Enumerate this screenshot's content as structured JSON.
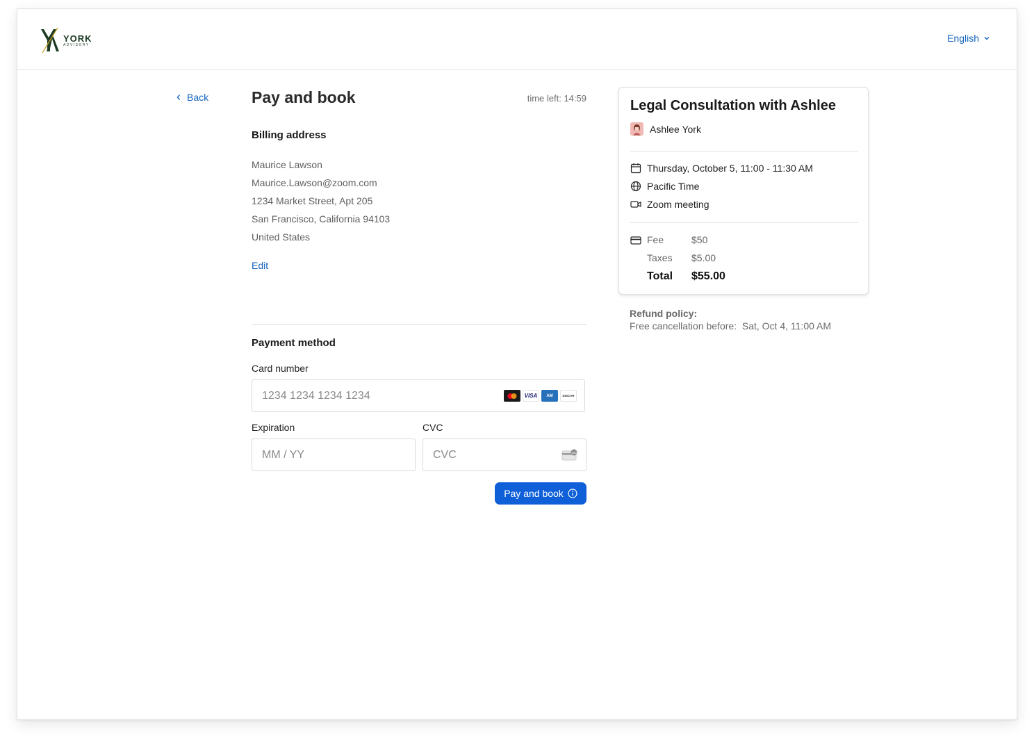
{
  "header": {
    "logo_mark": "YA",
    "logo_name": "YORK",
    "logo_sub": "ADVISORY",
    "language": "English"
  },
  "nav": {
    "back_label": "Back"
  },
  "checkout": {
    "title": "Pay and book",
    "timer": "time left: 14:59",
    "billing": {
      "title": "Billing address",
      "lines": [
        "Maurice Lawson",
        "Maurice.Lawson@zoom.com",
        "1234 Market Street, Apt 205",
        "San Francisco, California 94103",
        "United States"
      ],
      "edit_label": "Edit"
    },
    "payment": {
      "title": "Payment method",
      "card_label": "Card number",
      "card_placeholder": "1234 1234 1234 1234",
      "expiration_label": "Expiration",
      "expiration_placeholder": "MM / YY",
      "cvc_label": "CVC",
      "cvc_placeholder": "CVC",
      "card_brands": [
        "mastercard-icon",
        "visa-icon",
        "amex-icon",
        "discover-icon"
      ]
    },
    "submit_label": "Pay and book"
  },
  "summary": {
    "title": "Legal Consultation with Ashlee",
    "host": "Ashlee York",
    "date": "Thursday, October 5, 11:00 - 11:30 AM",
    "timezone": "Pacific Time",
    "location": "Zoom meeting",
    "fee_label": "Fee",
    "fee_value": "$50",
    "taxes_label": "Taxes",
    "taxes_value": "$5.00",
    "total_label": "Total",
    "total_value": "$55.00"
  },
  "refund": {
    "title": "Refund policy:",
    "text": "Free cancellation before:  Sat, Oct 4, 11:00 AM"
  },
  "colors": {
    "accent": "#1565c0",
    "button": "#0e5fd8",
    "brand_green": "#1d3b22"
  }
}
